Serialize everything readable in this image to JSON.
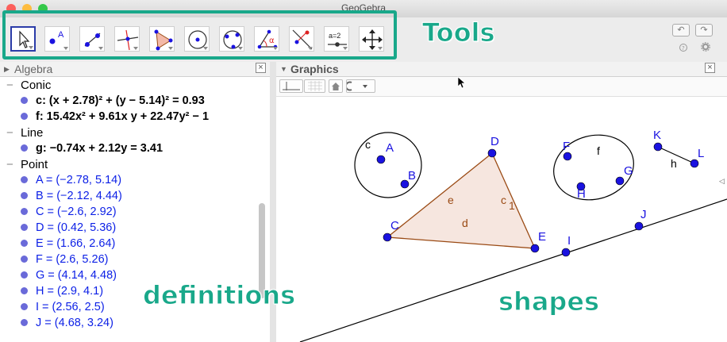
{
  "window": {
    "title": "GeoGebra",
    "traffic_colors": [
      "#fc605c",
      "#fdbc40",
      "#34c84a"
    ]
  },
  "toolbar": {
    "tools": [
      {
        "name": "move-tool",
        "icon": "arrow-pointer-icon",
        "selected": true
      },
      {
        "name": "point-tool",
        "icon": "point-icon",
        "label": "A"
      },
      {
        "name": "line-tool",
        "icon": "line-through-points-icon"
      },
      {
        "name": "perpendicular-line-tool",
        "icon": "perpendicular-line-icon"
      },
      {
        "name": "polygon-tool",
        "icon": "polygon-icon"
      },
      {
        "name": "circle-center-point-tool",
        "icon": "circle-center-icon"
      },
      {
        "name": "circle-three-points-tool",
        "icon": "circle-three-points-icon"
      },
      {
        "name": "angle-tool",
        "icon": "angle-icon",
        "label": "α"
      },
      {
        "name": "reflect-tool",
        "icon": "reflect-icon"
      },
      {
        "name": "slider-tool",
        "icon": "slider-icon",
        "label": "a=2"
      },
      {
        "name": "move-graphics-view-tool",
        "icon": "move-view-icon"
      }
    ],
    "undo_label": "↶",
    "redo_label": "↷",
    "help_icon": "help-icon",
    "settings_icon": "gear-icon"
  },
  "annotations": {
    "tools": "Tools",
    "definitions": "definitions",
    "shapes": "shapes",
    "color": "#19a88a"
  },
  "algebra": {
    "title": "Algebra",
    "close": "×",
    "categories": [
      {
        "label": "Conic",
        "items": [
          {
            "label": "c: (x + 2.78)² + (y − 5.14)² = 0.93",
            "style": "black"
          },
          {
            "label": "f: 15.42x² + 9.61x y + 22.47y² − 1",
            "style": "black"
          }
        ]
      },
      {
        "label": "Line",
        "items": [
          {
            "label": "g: −0.74x + 2.12y = 3.41",
            "style": "black"
          }
        ]
      },
      {
        "label": "Point",
        "items": [
          {
            "label": "A = (−2.78, 5.14)",
            "style": "blue"
          },
          {
            "label": "B = (−2.12, 4.44)",
            "style": "blue"
          },
          {
            "label": "C = (−2.6, 2.92)",
            "style": "blue"
          },
          {
            "label": "D = (0.42, 5.36)",
            "style": "blue"
          },
          {
            "label": "E = (1.66, 2.64)",
            "style": "blue"
          },
          {
            "label": "F = (2.6, 5.26)",
            "style": "blue"
          },
          {
            "label": "G = (4.14, 4.48)",
            "style": "blue"
          },
          {
            "label": "H = (2.9, 4.1)",
            "style": "blue"
          },
          {
            "label": "I = (2.56, 2.5)",
            "style": "blue"
          },
          {
            "label": "J = (4.68, 3.24)",
            "style": "blue"
          }
        ]
      }
    ]
  },
  "graphics": {
    "title": "Graphics",
    "close": "×",
    "point_color": "#1a12e0",
    "polygon_stroke": "#9a4a14",
    "polygon_fill": "#f6e6df",
    "points": [
      {
        "name": "A"
      },
      {
        "name": "B"
      },
      {
        "name": "C"
      },
      {
        "name": "D"
      },
      {
        "name": "E"
      },
      {
        "name": "F"
      },
      {
        "name": "G"
      },
      {
        "name": "H"
      },
      {
        "name": "I"
      },
      {
        "name": "J"
      },
      {
        "name": "K"
      },
      {
        "name": "L"
      }
    ],
    "object_labels": {
      "circle": "c",
      "ellipse": "f",
      "segment_kl": "h",
      "side_e": "e",
      "side_d": "d",
      "side_c1": "c",
      "side_c1_sub": "1"
    }
  }
}
